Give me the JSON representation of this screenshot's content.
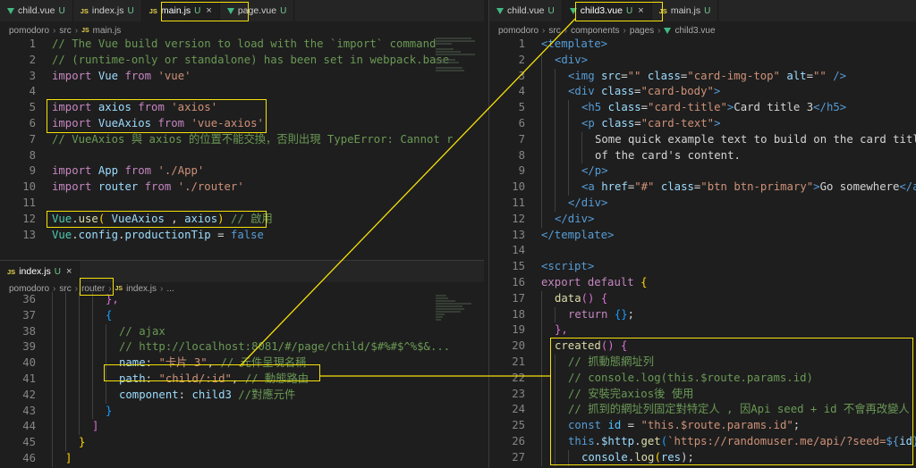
{
  "left_top": {
    "tabs": [
      {
        "label": "child.vue",
        "status": "U",
        "kind": "vue",
        "active": false,
        "highlighted": false
      },
      {
        "label": "index.js",
        "status": "U",
        "kind": "js",
        "active": false,
        "highlighted": false
      },
      {
        "label": "main.js",
        "status": "U",
        "kind": "js",
        "active": true,
        "highlighted": true
      },
      {
        "label": "page.vue",
        "status": "U",
        "kind": "vue",
        "active": false,
        "highlighted": false
      }
    ],
    "breadcrumb": [
      "pomodoro",
      "src",
      "main.js"
    ],
    "first_line": 1,
    "lines": [
      [
        [
          "// The Vue build version to load with the `import` command",
          "com"
        ]
      ],
      [
        [
          "// (runtime-only or standalone) has been set in webpack.base",
          "com"
        ]
      ],
      [
        [
          "import",
          "kw"
        ],
        [
          " Vue ",
          "var"
        ],
        [
          "from",
          "kw"
        ],
        [
          " ",
          "txt"
        ],
        [
          "'vue'",
          "str"
        ]
      ],
      [],
      [
        [
          "import",
          "kw"
        ],
        [
          " axios ",
          "var"
        ],
        [
          "from",
          "kw"
        ],
        [
          " ",
          "txt"
        ],
        [
          "'axios'",
          "str"
        ]
      ],
      [
        [
          "import",
          "kw"
        ],
        [
          " VueAxios ",
          "var"
        ],
        [
          "from",
          "kw"
        ],
        [
          " ",
          "txt"
        ],
        [
          "'vue-axios'",
          "str"
        ]
      ],
      [
        [
          "// VueAxios 與 axios 的位置不能交換，否則出現 TypeError: Cannot r",
          "com"
        ]
      ],
      [],
      [
        [
          "import",
          "kw"
        ],
        [
          " App ",
          "var"
        ],
        [
          "from",
          "kw"
        ],
        [
          " ",
          "txt"
        ],
        [
          "'./App'",
          "str"
        ]
      ],
      [
        [
          "import",
          "kw"
        ],
        [
          " router ",
          "var"
        ],
        [
          "from",
          "kw"
        ],
        [
          " ",
          "txt"
        ],
        [
          "'./router'",
          "str"
        ]
      ],
      [],
      [
        [
          "Vue",
          "cls"
        ],
        [
          ".",
          "txt"
        ],
        [
          "use",
          "fn"
        ],
        [
          "(",
          "br1"
        ],
        [
          " VueAxios ",
          "var"
        ],
        [
          ", ",
          "txt"
        ],
        [
          "axios",
          "var"
        ],
        [
          ")",
          "br1"
        ],
        [
          " // 啟用",
          "com"
        ]
      ],
      [
        [
          "Vue",
          "cls"
        ],
        [
          ".",
          "txt"
        ],
        [
          "config",
          "var"
        ],
        [
          ".",
          "txt"
        ],
        [
          "productionTip",
          "var"
        ],
        [
          " = ",
          "txt"
        ],
        [
          "false",
          "blue"
        ]
      ]
    ]
  },
  "left_bottom": {
    "tabs": [
      {
        "label": "index.js",
        "status": "U",
        "kind": "js",
        "active": true,
        "highlighted": false
      }
    ],
    "breadcrumb": [
      "pomodoro",
      "src",
      "router",
      "index.js",
      "..."
    ],
    "first_line": 36,
    "lines": [
      [
        [
          "},",
          "br2"
        ]
      ],
      [
        [
          "{",
          "br3"
        ]
      ],
      [
        [
          "// ajax",
          "com"
        ]
      ],
      [
        [
          "// http://localhost:8081/#/page/child/$#%#$^%$&...",
          "com"
        ]
      ],
      [
        [
          "name",
          "var"
        ],
        [
          ": ",
          "txt"
        ],
        [
          "\"卡片 3\"",
          "str"
        ],
        [
          ", ",
          "txt"
        ],
        [
          "// 元件呈現名稱",
          "com"
        ]
      ],
      [
        [
          "path",
          "var"
        ],
        [
          ": ",
          "txt"
        ],
        [
          "\"child/:id\"",
          "str"
        ],
        [
          ", ",
          "txt"
        ],
        [
          "// 動態路由",
          "com"
        ]
      ],
      [
        [
          "component",
          "var"
        ],
        [
          ": ",
          "txt"
        ],
        [
          "child3",
          "var"
        ],
        [
          " ",
          "txt"
        ],
        [
          "//對應元件",
          "com"
        ]
      ],
      [
        [
          "}",
          "br3"
        ]
      ],
      [
        [
          "]",
          "br2"
        ]
      ],
      [
        [
          "}",
          "br1"
        ]
      ],
      [
        [
          "]",
          "br1"
        ]
      ],
      [
        [
          "};",
          "txt"
        ]
      ]
    ]
  },
  "right": {
    "tabs": [
      {
        "label": "child.vue",
        "status": "U",
        "kind": "vue",
        "active": false,
        "highlighted": false
      },
      {
        "label": "child3.vue",
        "status": "U",
        "kind": "vue",
        "active": true,
        "highlighted": true
      },
      {
        "label": "main.js",
        "status": "U",
        "kind": "js",
        "active": false,
        "highlighted": false
      }
    ],
    "breadcrumb": [
      "pomodoro",
      "src",
      "components",
      "pages",
      "child3.vue"
    ],
    "first_line": 1,
    "lines": [
      [
        [
          "<template>",
          "tag"
        ]
      ],
      [
        [
          "<div>",
          "tag"
        ]
      ],
      [
        [
          "<img",
          "tag"
        ],
        [
          " src",
          "attr"
        ],
        [
          "=",
          "txt"
        ],
        [
          "\"\"",
          "str"
        ],
        [
          " class",
          "attr"
        ],
        [
          "=",
          "txt"
        ],
        [
          "\"card-img-top\"",
          "str"
        ],
        [
          " alt",
          "attr"
        ],
        [
          "=",
          "txt"
        ],
        [
          "\"\"",
          "str"
        ],
        [
          " />",
          "tag"
        ]
      ],
      [
        [
          "<div",
          "tag"
        ],
        [
          " class",
          "attr"
        ],
        [
          "=",
          "txt"
        ],
        [
          "\"card-body\"",
          "str"
        ],
        [
          ">",
          "tag"
        ]
      ],
      [
        [
          "<h5",
          "tag"
        ],
        [
          " class",
          "attr"
        ],
        [
          "=",
          "txt"
        ],
        [
          "\"card-title\"",
          "str"
        ],
        [
          ">",
          "tag"
        ],
        [
          "Card title 3",
          "txt"
        ],
        [
          "</h5>",
          "tag"
        ]
      ],
      [
        [
          "<p",
          "tag"
        ],
        [
          " class",
          "attr"
        ],
        [
          "=",
          "txt"
        ],
        [
          "\"card-text\"",
          "str"
        ],
        [
          ">",
          "tag"
        ]
      ],
      [
        [
          "Some quick example text to build on the card title",
          "txt"
        ]
      ],
      [
        [
          "of the card's content.",
          "txt"
        ]
      ],
      [
        [
          "</p>",
          "tag"
        ]
      ],
      [
        [
          "<a",
          "tag"
        ],
        [
          " href",
          "attr"
        ],
        [
          "=",
          "txt"
        ],
        [
          "\"#\"",
          "str"
        ],
        [
          " class",
          "attr"
        ],
        [
          "=",
          "txt"
        ],
        [
          "\"btn btn-primary\"",
          "str"
        ],
        [
          ">",
          "tag"
        ],
        [
          "Go somewhere",
          "txt"
        ],
        [
          "</a>",
          "tag"
        ]
      ],
      [
        [
          "</div>",
          "tag"
        ]
      ],
      [
        [
          "</div>",
          "tag"
        ]
      ],
      [
        [
          "</template>",
          "tag"
        ]
      ],
      [],
      [
        [
          "<script>",
          "tag"
        ]
      ],
      [
        [
          "export",
          "kw"
        ],
        [
          " ",
          "txt"
        ],
        [
          "default",
          "kw"
        ],
        [
          " ",
          "txt"
        ],
        [
          "{",
          "br1"
        ]
      ],
      [
        [
          "data",
          "fn"
        ],
        [
          "()",
          "br2"
        ],
        [
          " ",
          "txt"
        ],
        [
          "{",
          "br2"
        ]
      ],
      [
        [
          "return",
          "kw"
        ],
        [
          " ",
          "txt"
        ],
        [
          "{}",
          "br3"
        ],
        [
          ";",
          "txt"
        ]
      ],
      [
        [
          "},",
          "br2"
        ]
      ],
      [
        [
          "created",
          "fn"
        ],
        [
          "()",
          "br2"
        ],
        [
          " ",
          "txt"
        ],
        [
          "{",
          "br2"
        ]
      ],
      [
        [
          "// 抓動態網址列",
          "com"
        ]
      ],
      [
        [
          "// console.log(this.$route.params.id)",
          "com"
        ]
      ],
      [
        [
          "// 安裝完axios後 使用",
          "com"
        ]
      ],
      [
        [
          "// 抓到的網址列固定對特定人 , 因Api seed + id 不會再改變人",
          "com"
        ]
      ],
      [
        [
          "const",
          "blue"
        ],
        [
          " ",
          "txt"
        ],
        [
          "id",
          "const"
        ],
        [
          " = ",
          "txt"
        ],
        [
          "\"this.$route.params.id\"",
          "str"
        ],
        [
          ";",
          "txt"
        ]
      ],
      [
        [
          "this",
          "blue"
        ],
        [
          ".",
          "txt"
        ],
        [
          "$http",
          "var"
        ],
        [
          ".",
          "txt"
        ],
        [
          "get",
          "fn"
        ],
        [
          "(",
          "br3"
        ],
        [
          "`https://randomuser.me/api/?seed=",
          "str"
        ],
        [
          "${",
          "blue"
        ],
        [
          "id",
          "var"
        ],
        [
          "}",
          "blue"
        ],
        [
          "`",
          "str"
        ],
        [
          ")",
          "br3"
        ]
      ],
      [
        [
          "console",
          "var"
        ],
        [
          ".",
          "txt"
        ],
        [
          "log",
          "fn"
        ],
        [
          "(",
          "br1"
        ],
        [
          "res",
          "var"
        ],
        [
          ");",
          "txt"
        ]
      ]
    ]
  },
  "colors": {
    "highlight": "#f5e10a",
    "background": "#1e1e1e",
    "tabbar": "#252526"
  }
}
